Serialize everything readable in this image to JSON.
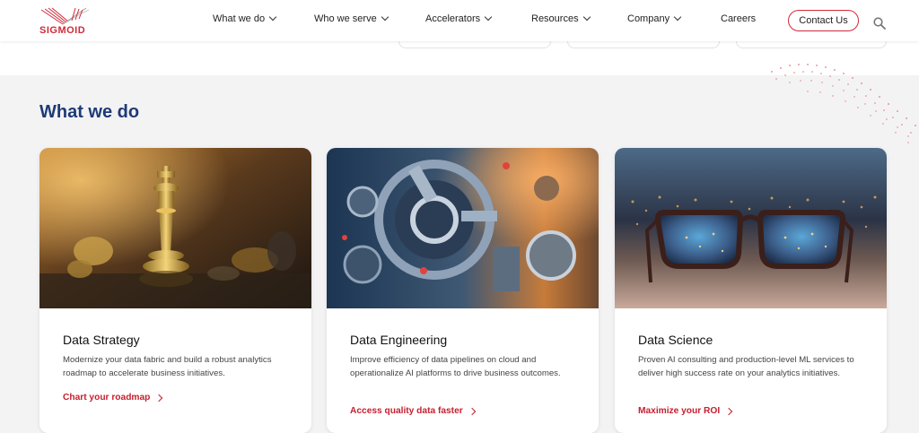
{
  "brand": {
    "name": "SIGMOID",
    "accent": "#d02a3a"
  },
  "nav": {
    "items": [
      {
        "label": "What we do",
        "dropdown": true
      },
      {
        "label": "Who we serve",
        "dropdown": true
      },
      {
        "label": "Accelerators",
        "dropdown": true
      },
      {
        "label": "Resources",
        "dropdown": true
      },
      {
        "label": "Company",
        "dropdown": true
      },
      {
        "label": "Careers",
        "dropdown": false
      }
    ],
    "contact_label": "Contact Us",
    "search_icon": "search-icon"
  },
  "section": {
    "title": "What we do",
    "title_color": "#1e3a78"
  },
  "cards": [
    {
      "image": "chess-king-image",
      "title": "Data Strategy",
      "desc": "Modernize your data fabric and build a robust analytics roadmap to accelerate business initiatives.",
      "link": "Chart your roadmap"
    },
    {
      "image": "machinery-gears-image",
      "title": "Data Engineering",
      "desc": "Improve efficiency of data pipelines on cloud and operationalize AI platforms to drive business outcomes.",
      "link": "Access quality data faster"
    },
    {
      "image": "eyeglasses-city-image",
      "title": "Data Science",
      "desc": "Proven AI consulting and production-level ML services to deliver high success rate on your analytics initiatives.",
      "link": "Maximize your ROI"
    }
  ],
  "colors": {
    "link": "#c5202e",
    "background": "#f3f3f4"
  }
}
